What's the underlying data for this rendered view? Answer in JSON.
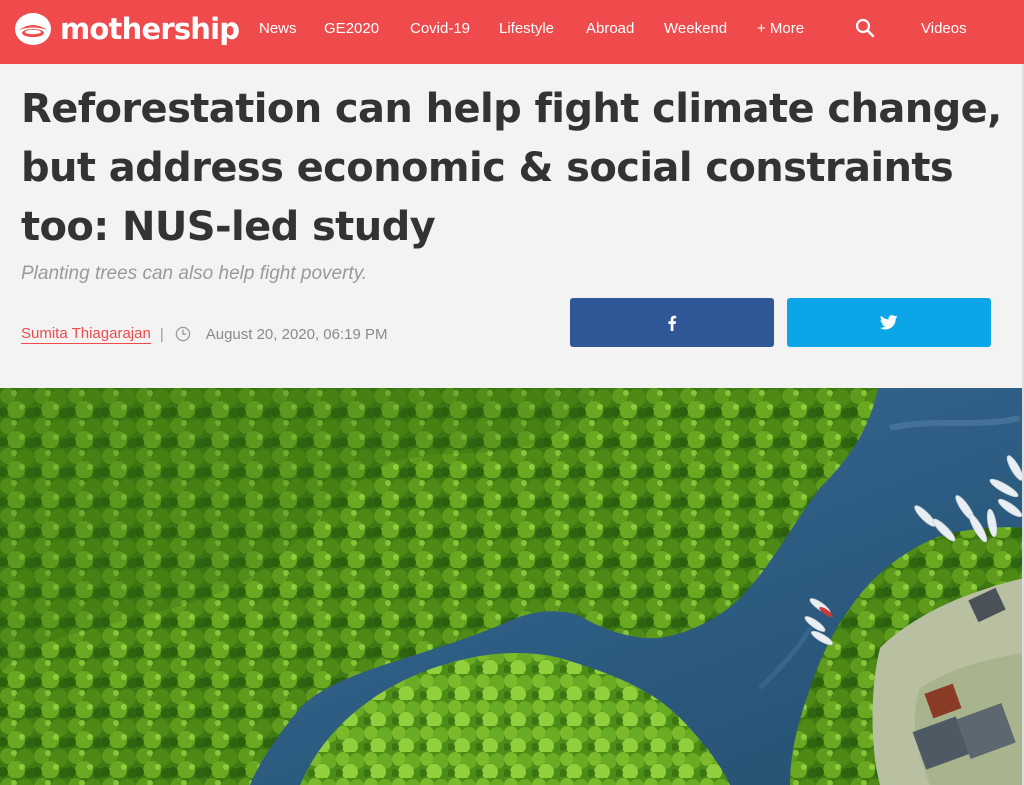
{
  "brand": {
    "name": "mothership",
    "accent_color": "#ef4b4d",
    "logo_icon": "mothership-logo-icon"
  },
  "nav": {
    "items": [
      {
        "label": "News"
      },
      {
        "label": "GE2020"
      },
      {
        "label": "Covid-19"
      },
      {
        "label": "Lifestyle"
      },
      {
        "label": "Abroad"
      },
      {
        "label": "Weekend"
      },
      {
        "label": "+ More"
      }
    ],
    "search_icon": "search-icon",
    "videos_label": "Videos"
  },
  "article": {
    "headline": "Reforestation can help fight climate change, but address economic & social constraints too: NUS-led study",
    "subtitle": "Planting trees can also help fight poverty.",
    "author": "Sumita Thiagarajan",
    "separator": "|",
    "date": "August 20, 2020, 06:19 PM",
    "clock_icon": "clock-icon"
  },
  "share": {
    "facebook": {
      "icon": "facebook-icon",
      "color": "#2f5797"
    },
    "twitter": {
      "icon": "twitter-icon",
      "color": "#0ca5e8"
    }
  },
  "hero_image": {
    "subject": "aerial-mangrove-forest-river-boats"
  }
}
